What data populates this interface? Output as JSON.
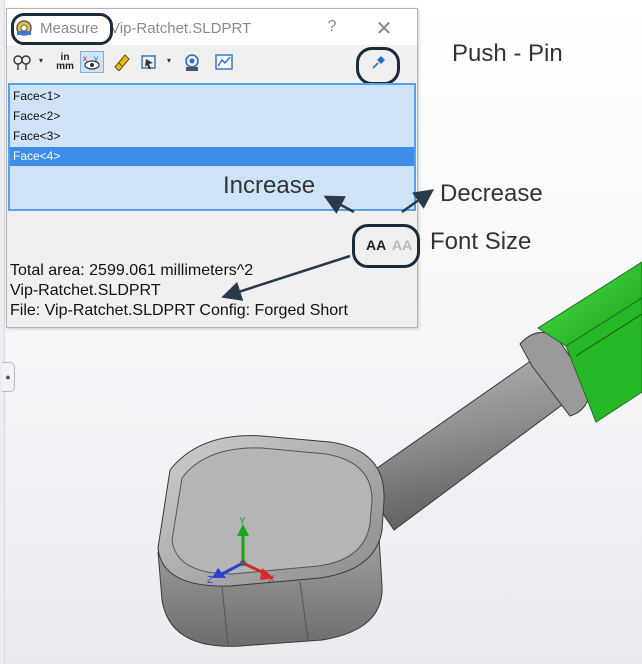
{
  "window": {
    "title_tool": "Measure",
    "title_file": "Vip-Ratchet.SLDPRT",
    "help_glyph": "?",
    "close_glyph": "✕"
  },
  "toolbar": {
    "icons": [
      "arc-circle-icon",
      "units-precision-icon",
      "show-xyz-icon",
      "point-to-point-icon",
      "projection-icon",
      "sensor-icon",
      "history-icon",
      "push-pin-icon"
    ],
    "units_text_top": "in",
    "units_text_bottom": "mm",
    "dropdown_caret": "▾"
  },
  "selection_list": {
    "items": [
      "Face<1>",
      "Face<2>",
      "Face<3>",
      "Face<4>"
    ],
    "selected_index": 3
  },
  "font_size_buttons": {
    "increase_glyph": "AA",
    "decrease_glyph": "AA"
  },
  "results": {
    "lines": [
      "Total area: 2599.061 millimeters^2",
      "Vip-Ratchet.SLDPRT",
      "File: Vip-Ratchet.SLDPRT Config: Forged Short"
    ]
  },
  "annotations": {
    "push_pin": "Push - Pin",
    "increase": "Increase",
    "decrease": "Decrease",
    "font_size": "Font Size"
  },
  "triad": {
    "x": "X",
    "y": "Y",
    "z": "Z"
  },
  "colors": {
    "selected_face_green": "#2ecf2e",
    "list_background": "#cfe3f8",
    "list_selected": "#3d8ee8",
    "callout_outline": "#1c2b3a",
    "model_gray": "#8e8e8e"
  }
}
